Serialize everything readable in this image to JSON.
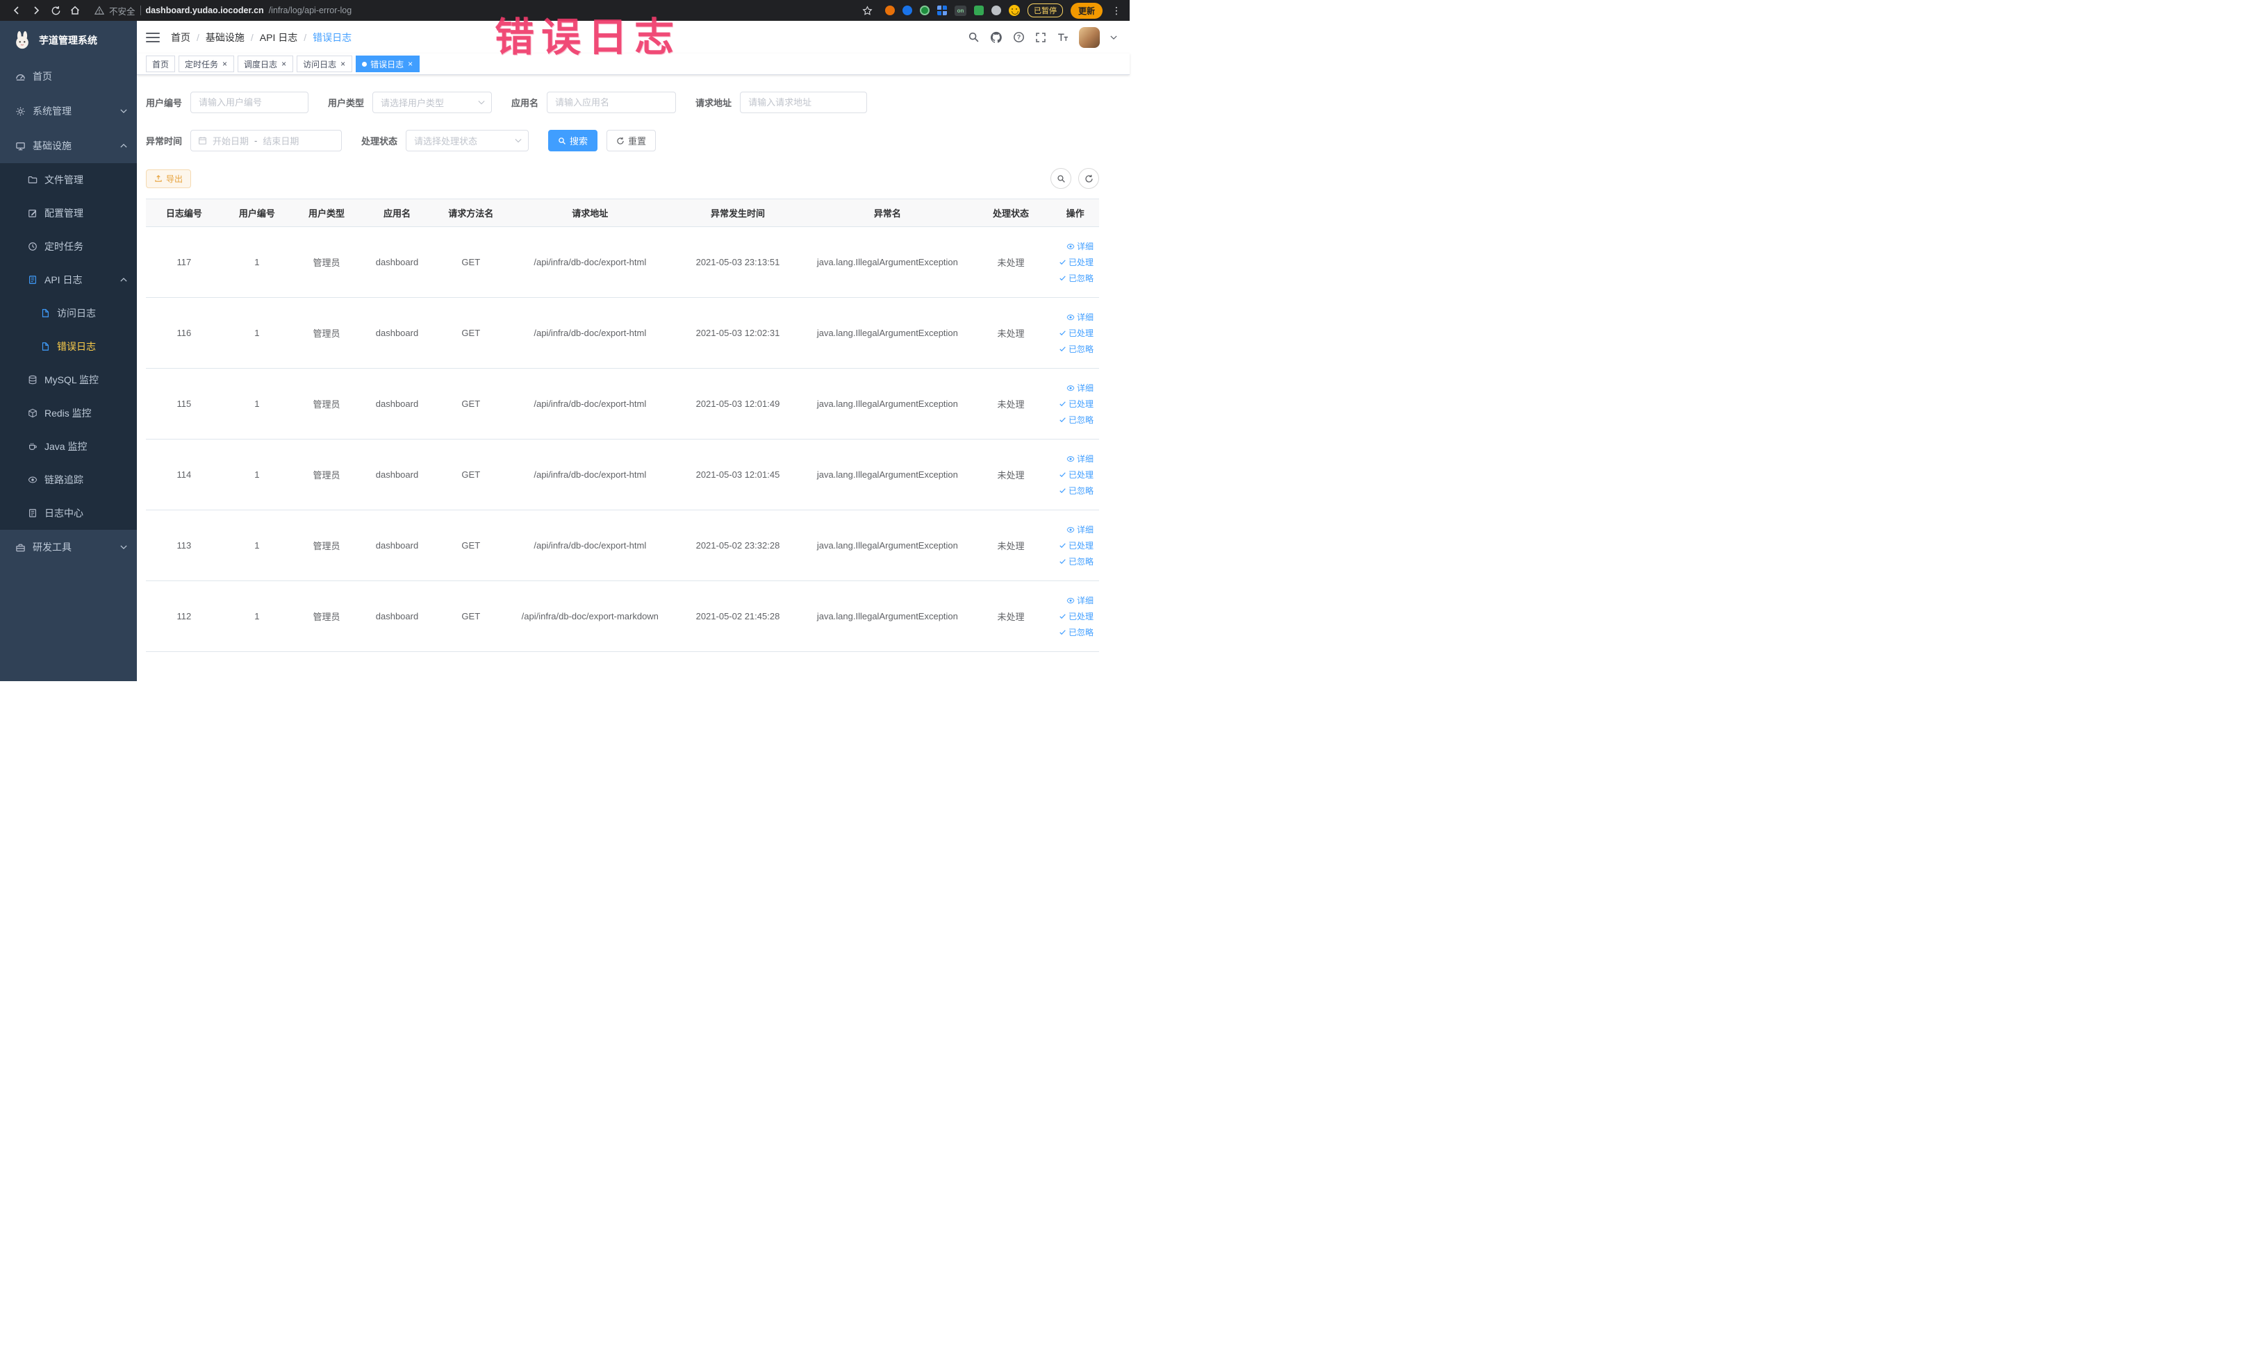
{
  "browser": {
    "security_label": "不安全",
    "url_host": "dashboard.yudao.iocoder.cn",
    "url_path": "/infra/log/api-error-log",
    "paused_badge": "已暂停",
    "update_button": "更新"
  },
  "annotation": {
    "text": "错误日志"
  },
  "colors": {
    "primary": "#409eff",
    "warning": "#e6a23c",
    "sidebar_bg": "#304156",
    "submenu_bg": "#1f2d3d",
    "active_menu_text": "#ffd04b",
    "annotation_pink": "#ee3a6a"
  },
  "sidebar": {
    "logo_title": "芋道管理系统",
    "items": [
      {
        "label": "首页",
        "icon": "gauge-icon",
        "level": 1
      },
      {
        "label": "系统管理",
        "icon": "gear-icon",
        "level": 1,
        "arrow": "down"
      },
      {
        "label": "基础设施",
        "icon": "monitor-icon",
        "level": 1,
        "arrow": "up"
      },
      {
        "label": "文件管理",
        "icon": "folder-icon",
        "level": 2
      },
      {
        "label": "配置管理",
        "icon": "edit-icon",
        "level": 2
      },
      {
        "label": "定时任务",
        "icon": "clock-icon",
        "level": 2
      },
      {
        "label": "API 日志",
        "icon": "log-icon",
        "level": 2,
        "arrow": "up"
      },
      {
        "label": "访问日志",
        "icon": "doc-icon",
        "level": 3
      },
      {
        "label": "错误日志",
        "icon": "doc-icon",
        "level": 3,
        "active": true
      },
      {
        "label": "MySQL 监控",
        "icon": "database-icon",
        "level": 2
      },
      {
        "label": "Redis 监控",
        "icon": "cube-icon",
        "level": 2
      },
      {
        "label": "Java 监控",
        "icon": "coffee-icon",
        "level": 2
      },
      {
        "label": "链路追踪",
        "icon": "eye-icon",
        "level": 2
      },
      {
        "label": "日志中心",
        "icon": "doc-icon",
        "level": 2
      },
      {
        "label": "研发工具",
        "icon": "toolbox-icon",
        "level": 1,
        "arrow": "down"
      }
    ]
  },
  "navbar": {
    "breadcrumb": [
      "首页",
      "基础设施",
      "API 日志",
      "错误日志"
    ]
  },
  "tabs": [
    {
      "label": "首页",
      "closable": false,
      "active": false
    },
    {
      "label": "定时任务",
      "closable": true,
      "active": false
    },
    {
      "label": "调度日志",
      "closable": true,
      "active": false
    },
    {
      "label": "访问日志",
      "closable": true,
      "active": false
    },
    {
      "label": "错误日志",
      "closable": true,
      "active": true
    }
  ],
  "filters": {
    "user_id": {
      "label": "用户编号",
      "placeholder": "请输入用户编号"
    },
    "user_type": {
      "label": "用户类型",
      "placeholder": "请选择用户类型"
    },
    "app_name": {
      "label": "应用名",
      "placeholder": "请输入应用名"
    },
    "request_url": {
      "label": "请求地址",
      "placeholder": "请输入请求地址"
    },
    "exception_time": {
      "label": "异常时间",
      "start_placeholder": "开始日期",
      "separator": "-",
      "end_placeholder": "结束日期"
    },
    "process_status": {
      "label": "处理状态",
      "placeholder": "请选择处理状态"
    },
    "search_button": "搜索",
    "reset_button": "重置"
  },
  "toolbar": {
    "export_button": "导出"
  },
  "table": {
    "columns": [
      "日志编号",
      "用户编号",
      "用户类型",
      "应用名",
      "请求方法名",
      "请求地址",
      "异常发生时间",
      "异常名",
      "处理状态",
      "操作"
    ],
    "actions": [
      "详细",
      "已处理",
      "已忽略"
    ],
    "rows": [
      {
        "id": "117",
        "user_id": "1",
        "user_type": "管理员",
        "app": "dashboard",
        "method": "GET",
        "url": "/api/infra/db-doc/export-html",
        "time": "2021-05-03 23:13:51",
        "exception": "java.lang.IllegalArgumentException",
        "status": "未处理"
      },
      {
        "id": "116",
        "user_id": "1",
        "user_type": "管理员",
        "app": "dashboard",
        "method": "GET",
        "url": "/api/infra/db-doc/export-html",
        "time": "2021-05-03 12:02:31",
        "exception": "java.lang.IllegalArgumentException",
        "status": "未处理"
      },
      {
        "id": "115",
        "user_id": "1",
        "user_type": "管理员",
        "app": "dashboard",
        "method": "GET",
        "url": "/api/infra/db-doc/export-html",
        "time": "2021-05-03 12:01:49",
        "exception": "java.lang.IllegalArgumentException",
        "status": "未处理"
      },
      {
        "id": "114",
        "user_id": "1",
        "user_type": "管理员",
        "app": "dashboard",
        "method": "GET",
        "url": "/api/infra/db-doc/export-html",
        "time": "2021-05-03 12:01:45",
        "exception": "java.lang.IllegalArgumentException",
        "status": "未处理"
      },
      {
        "id": "113",
        "user_id": "1",
        "user_type": "管理员",
        "app": "dashboard",
        "method": "GET",
        "url": "/api/infra/db-doc/export-html",
        "time": "2021-05-02 23:32:28",
        "exception": "java.lang.IllegalArgumentException",
        "status": "未处理"
      },
      {
        "id": "112",
        "user_id": "1",
        "user_type": "管理员",
        "app": "dashboard",
        "method": "GET",
        "url": "/api/infra/db-doc/export-markdown",
        "time": "2021-05-02 21:45:28",
        "exception": "java.lang.IllegalArgumentException",
        "status": "未处理"
      }
    ]
  }
}
